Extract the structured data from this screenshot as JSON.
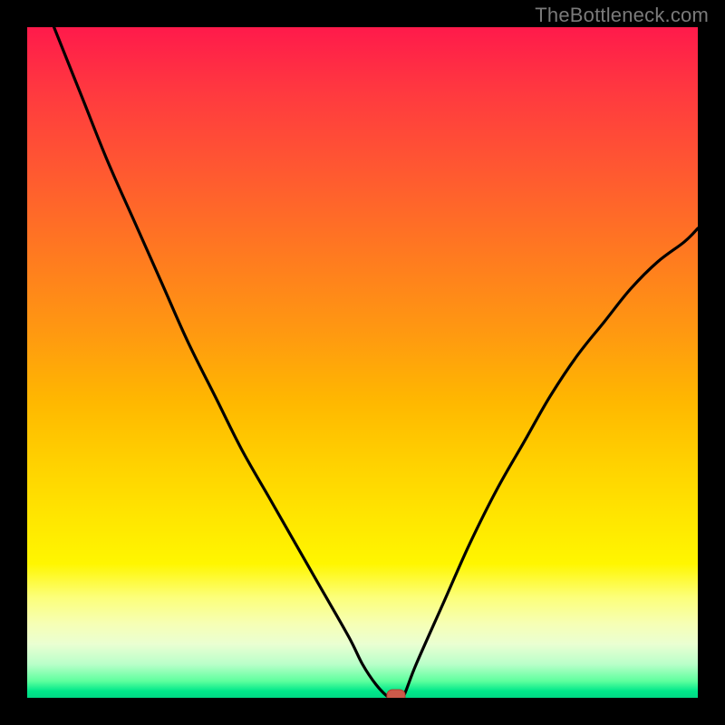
{
  "watermark": {
    "text": "TheBottleneck.com"
  },
  "colors": {
    "frame": "#000000",
    "curve_stroke": "#000000",
    "marker_fill": "#cc5a4a",
    "marker_stroke": "#b04030",
    "watermark": "#7a7a7a"
  },
  "chart_data": {
    "type": "line",
    "title": "",
    "xlabel": "",
    "ylabel": "",
    "xlim": [
      0,
      100
    ],
    "ylim": [
      0,
      100
    ],
    "grid": false,
    "series": [
      {
        "name": "bottleneck-curve",
        "x": [
          4,
          8,
          12,
          16,
          20,
          24,
          28,
          32,
          36,
          40,
          44,
          48,
          50,
          52,
          54,
          55,
          56,
          58,
          62,
          66,
          70,
          74,
          78,
          82,
          86,
          90,
          94,
          98,
          100
        ],
        "y": [
          100,
          90,
          80,
          71,
          62,
          53,
          45,
          37,
          30,
          23,
          16,
          9,
          5,
          2,
          0,
          0,
          0,
          5,
          14,
          23,
          31,
          38,
          45,
          51,
          56,
          61,
          65,
          68,
          70
        ]
      }
    ],
    "marker": {
      "x": 55,
      "y": 0,
      "shape": "rounded-rect"
    },
    "gradient_stops": [
      {
        "pos": 0.0,
        "color": "#ff1a4b"
      },
      {
        "pos": 0.5,
        "color": "#ffb800"
      },
      {
        "pos": 0.8,
        "color": "#fff600"
      },
      {
        "pos": 1.0,
        "color": "#00d884"
      }
    ]
  }
}
